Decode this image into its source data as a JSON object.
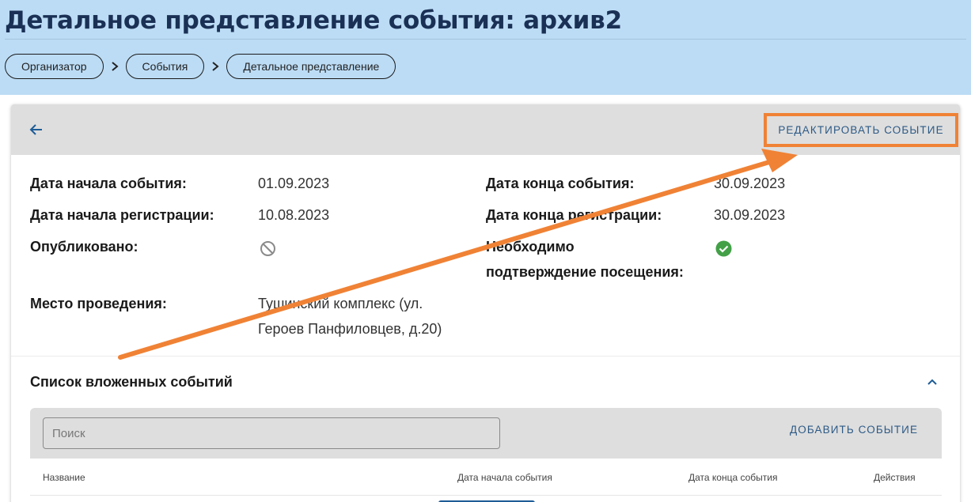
{
  "header": {
    "title": "Детальное представление события: архив2",
    "breadcrumbs": [
      "Организатор",
      "События",
      "Детальное представление"
    ]
  },
  "toolbar": {
    "back_icon": "arrow-left-icon",
    "edit_label": "РЕДАКТИРОВАТЬ СОБЫТИЕ"
  },
  "details": {
    "start_date_label": "Дата начала события:",
    "start_date_value": "01.09.2023",
    "end_date_label": "Дата конца события:",
    "end_date_value": "30.09.2023",
    "reg_start_label": "Дата начала регистрации:",
    "reg_start_value": "10.08.2023",
    "reg_end_label": "Дата конца регистрации:",
    "reg_end_value": "30.09.2023",
    "published_label": "Опубликовано:",
    "published_icon": "blocked-icon",
    "confirm_label_line1": "Необходимо",
    "confirm_label_line2": "подтверждение посещения:",
    "confirm_icon": "check-circle-icon",
    "venue_label": "Место проведения:",
    "venue_line1": "Тушинский комплекс (ул.",
    "venue_line2": "Героев Панфиловцев, д.20)"
  },
  "nested": {
    "title": "Список вложенных событий",
    "collapse_icon": "chevron-up-icon",
    "search_placeholder": "Поиск",
    "add_label": "ДОБАВИТЬ СОБЫТИЕ",
    "columns": [
      "Название",
      "Дата начала события",
      "Дата конца события",
      "Действия"
    ]
  },
  "colors": {
    "header_bg": "#bcdcf5",
    "accent_blue": "#1d5c96",
    "annotation_orange": "#f08235",
    "success_green": "#43a047"
  }
}
